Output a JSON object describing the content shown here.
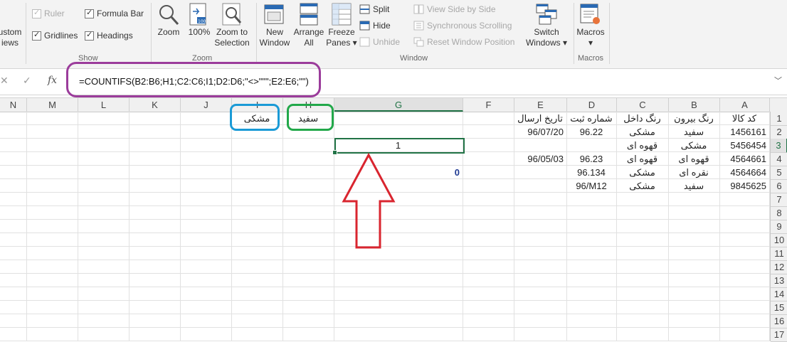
{
  "ribbon": {
    "view_custom": "Custom Views",
    "view_custom_line1": "ustom",
    "view_custom_line2": "iews",
    "show": {
      "ruler": "Ruler",
      "formula_bar": "Formula Bar",
      "gridlines": "Gridlines",
      "headings": "Headings",
      "group_label": "Show"
    },
    "zoom": {
      "zoom": "Zoom",
      "zoom100": "100%",
      "zoom_to_selection_1": "Zoom to",
      "zoom_to_selection_2": "Selection",
      "group_label": "Zoom"
    },
    "window": {
      "new_window_1": "New",
      "new_window_2": "Window",
      "arrange_all_1": "Arrange",
      "arrange_all_2": "All",
      "freeze_panes_1": "Freeze",
      "freeze_panes_2": "Panes ▾",
      "split": "Split",
      "hide": "Hide",
      "unhide": "Unhide",
      "view_side_by_side": "View Side by Side",
      "synchronous_scrolling": "Synchronous Scrolling",
      "reset_window_position": "Reset Window Position",
      "switch_windows_1": "Switch",
      "switch_windows_2": "Windows ▾",
      "group_label": "Window"
    },
    "macros": {
      "label": "Macros",
      "dropdown": "▾",
      "group_label": "Macros"
    }
  },
  "formula_bar": {
    "cancel": "✕",
    "enter": "✓",
    "fx": "fx",
    "formula": "=COUNTIFS(B2:B6;H1;C2:C6;I1;D2:D6;\"<>\"\"\";E2:E6;\"\")"
  },
  "columns": [
    "N",
    "M",
    "L",
    "K",
    "J",
    "I",
    "H",
    "G",
    "F",
    "E",
    "D",
    "C",
    "B",
    "A"
  ],
  "rows": [
    "1",
    "2",
    "3",
    "4",
    "5",
    "6",
    "7",
    "8",
    "9",
    "10",
    "11",
    "12",
    "13",
    "14",
    "15",
    "16",
    "17"
  ],
  "cells": {
    "A1": "کد کالا",
    "B1": "رنگ بیرون",
    "C1": "رنگ داخل",
    "D1": "شماره ثبت",
    "E1": "تاریخ ارسال",
    "H1": "سفید",
    "I1": "مشکی",
    "A2": "1456161",
    "B2": "سفید",
    "C2": "مشکی",
    "D2": "96.22",
    "E2": "96/07/20",
    "A3": "5456454",
    "B3": "مشکی",
    "C3": "قهوه ای",
    "G3": "1",
    "A4": "4564661",
    "B4": "قهوه ای",
    "C4": "قهوه ای",
    "D4": "96.23",
    "E4": "96/05/03",
    "A5": "4564664",
    "B5": "نقره ای",
    "C5": "مشکی",
    "D5": "96.134",
    "G5": "0",
    "A6": "9845625",
    "B6": "سفید",
    "C6": "مشکی",
    "D6": "96/M12"
  },
  "annotations": {
    "formula_outline_color": "#9b3c9b",
    "h1_outline_color": "#22a84a",
    "i1_outline_color": "#1a9ad6",
    "arrow_color": "#d9252f"
  }
}
